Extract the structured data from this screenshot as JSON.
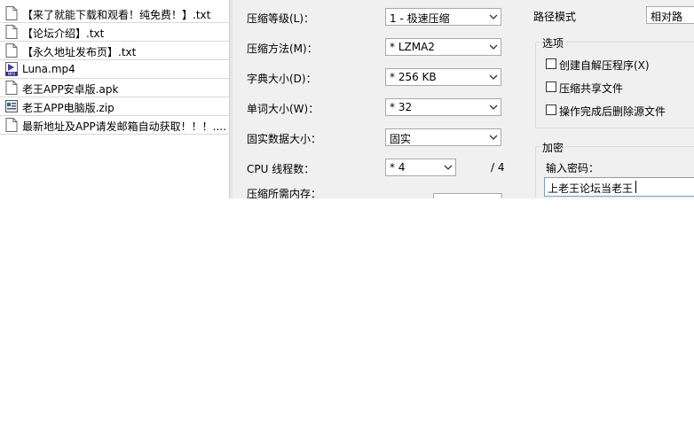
{
  "files": [
    {
      "name": "【来了就能下载和观看！纯免费！】.txt",
      "icon": "text-file-icon"
    },
    {
      "name": "【论坛介绍】.txt",
      "icon": "text-file-icon"
    },
    {
      "name": "【永久地址发布页】.txt",
      "icon": "text-file-icon"
    },
    {
      "name": "Luna.mp4",
      "icon": "video-file-icon",
      "icon_tag": "MP4"
    },
    {
      "name": "老王APP安卓版.apk",
      "icon": "apk-file-icon"
    },
    {
      "name": "老王APP电脑版.zip",
      "icon": "zip-file-icon"
    },
    {
      "name": "最新地址及APP请发邮箱自动获取！！！....",
      "icon": "text-file-icon"
    }
  ],
  "dialog": {
    "compression_level": {
      "label": "压缩等级(L)：",
      "value": "1 - 极速压缩"
    },
    "compression_method": {
      "label": "压缩方法(M)：",
      "value": "* LZMA2"
    },
    "dictionary_size": {
      "label": "字典大小(D)：",
      "value": "* 256 KB"
    },
    "word_size": {
      "label": "单词大小(W)：",
      "value": "* 32"
    },
    "solid_block_size": {
      "label": "固实数据大小：",
      "value": "固实"
    },
    "cpu_threads": {
      "label": "CPU 线程数：",
      "value": "* 4",
      "max": "/ 4"
    },
    "memory_usage": {
      "label": "压缩所需内存："
    },
    "path_mode": {
      "label": "路径模式",
      "value": "相对路"
    },
    "options": {
      "title": "选项",
      "items": [
        "创建自解压程序(X)",
        "压缩共享文件",
        "操作完成后删除源文件"
      ]
    },
    "encryption": {
      "title": "加密",
      "password_label": "输入密码：",
      "password_value": "上老王论坛当老王"
    }
  },
  "colors": {
    "dialog_bg": "#f0f0f0",
    "input_focus_border": "#7a9cd3"
  }
}
